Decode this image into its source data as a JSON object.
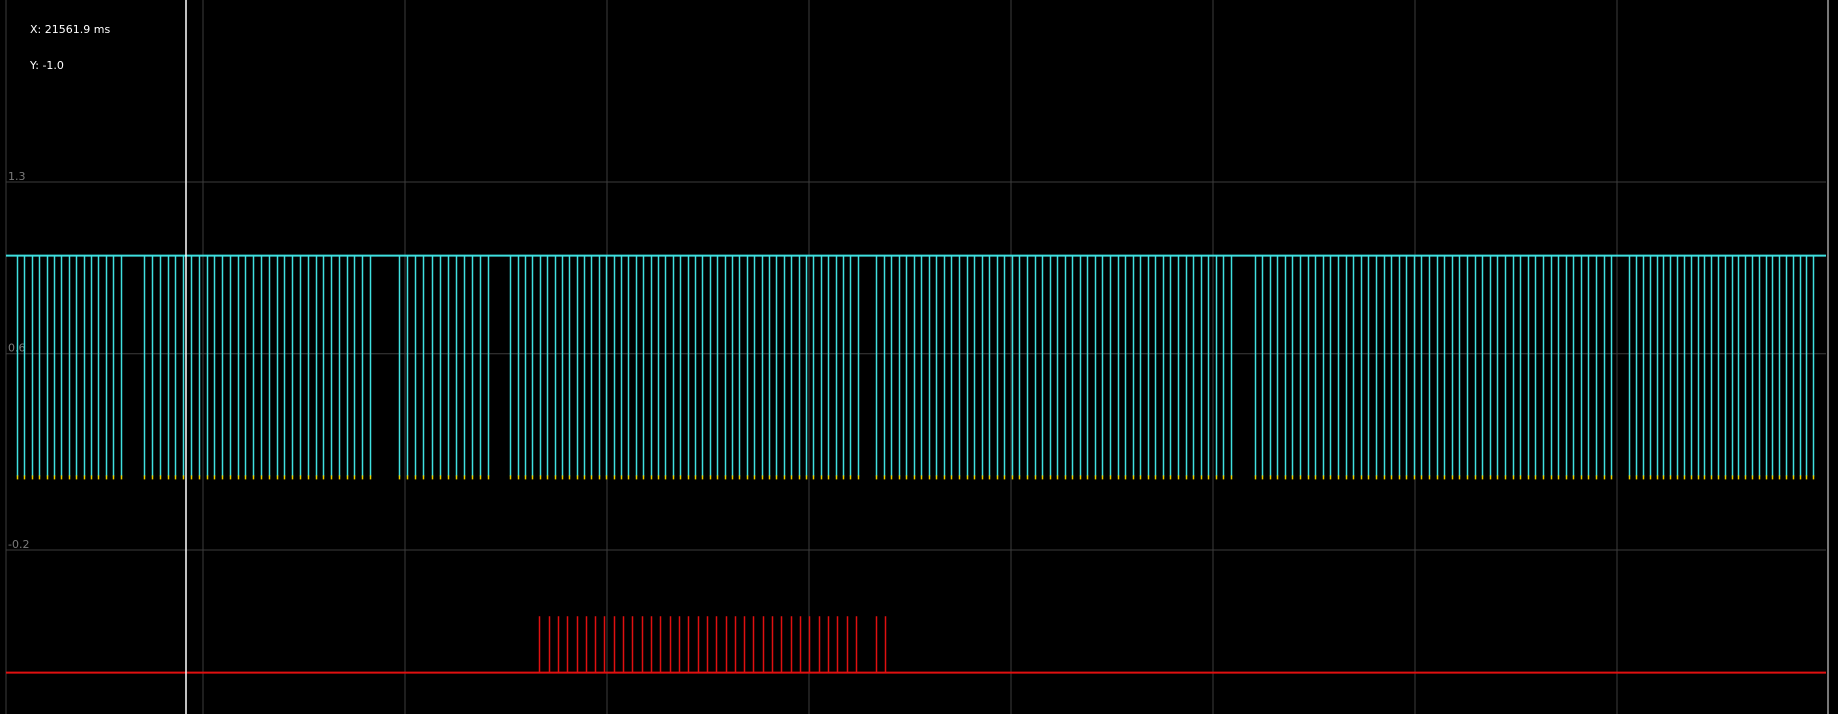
{
  "readout": {
    "x_text": "X: 21561.9 ms",
    "y_text": "Y: -1.0"
  },
  "colors": {
    "background": "#000000",
    "grid": "#3c3c3c",
    "cursor": "#ffffff",
    "trace_cyan": "#3fe0e0",
    "trace_tip": "#e8d200",
    "trace_red": "#e01010",
    "right_edge_line": "#a0a0a0"
  },
  "chart_data": {
    "type": "line",
    "grid": true,
    "y_tick_labels": [
      "1.3",
      "0.6",
      "-0.2"
    ],
    "cursor": {
      "x_ms": 21561.9,
      "y": -1.0
    },
    "series": [
      {
        "color": "#3fe0e0",
        "baseline": 1.0,
        "spike_to": 0.1,
        "groups": [
          {
            "count": 15,
            "x_start_frac": 0.006,
            "x_end_frac": 0.063
          },
          {
            "count": 30,
            "x_start_frac": 0.076,
            "x_end_frac": 0.2
          },
          {
            "count": 12,
            "x_start_frac": 0.216,
            "x_end_frac": 0.265
          },
          {
            "count": 48,
            "x_start_frac": 0.277,
            "x_end_frac": 0.468
          },
          {
            "count": 48,
            "x_start_frac": 0.478,
            "x_end_frac": 0.673
          },
          {
            "count": 48,
            "x_start_frac": 0.686,
            "x_end_frac": 0.882
          },
          {
            "count": 28,
            "x_start_frac": 0.892,
            "x_end_frac": 0.993
          }
        ]
      },
      {
        "color": "#e01010",
        "baseline": -0.7,
        "spike_to": -0.47,
        "groups": [
          {
            "count": 35,
            "x_start_frac": 0.293,
            "x_end_frac": 0.467
          },
          {
            "count": 2,
            "x_start_frac": 0.478,
            "x_end_frac": 0.483
          }
        ]
      }
    ]
  }
}
